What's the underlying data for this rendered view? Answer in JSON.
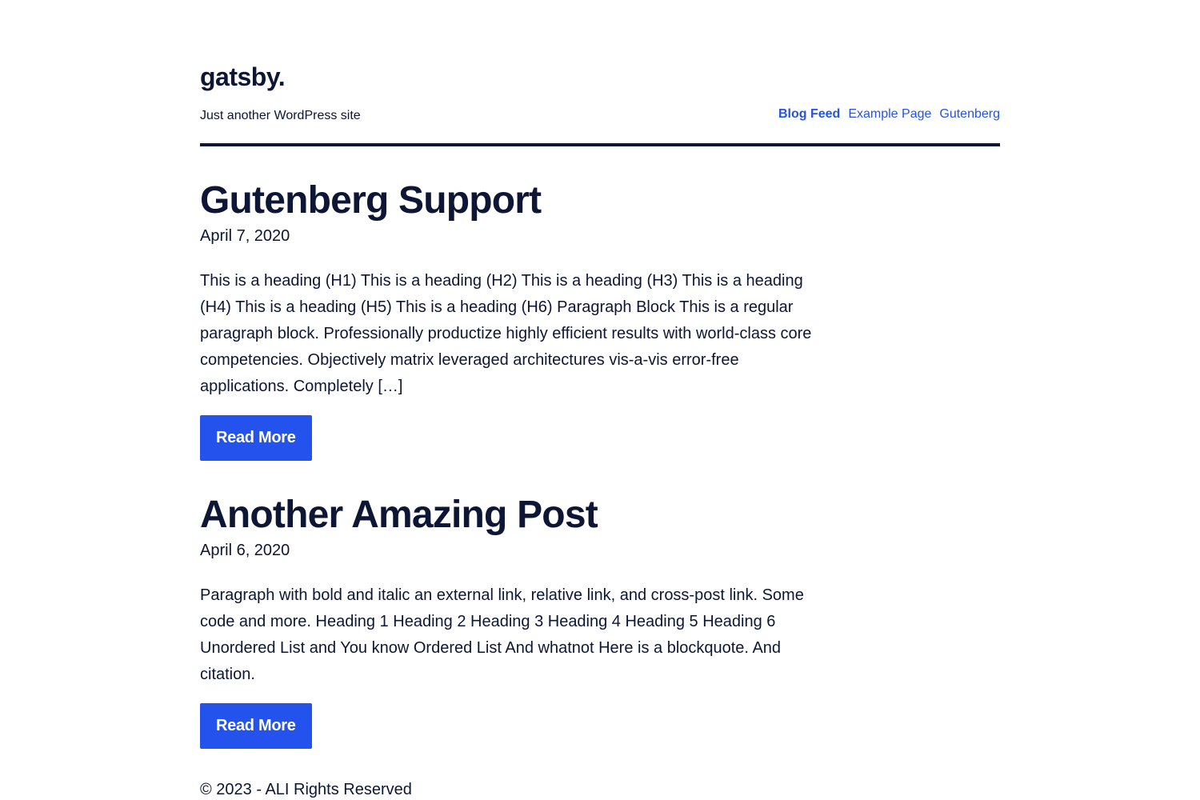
{
  "site": {
    "title": "gatsby.",
    "tagline": "Just another WordPress site"
  },
  "nav": {
    "items": [
      {
        "label": "Blog Feed"
      },
      {
        "label": "Example Page"
      },
      {
        "label": "Gutenberg"
      }
    ],
    "active": "Blog Feed"
  },
  "posts": [
    {
      "title": "Gutenberg Support",
      "date": "April 7, 2020",
      "excerpt": "This is a heading (H1) This is a heading (H2) This is a heading (H3) This is a heading (H4) This is a heading (H5) This is a heading (H6) Paragraph Block This is a regular paragraph block. Professionally productize highly efficient results with world-class core competencies. Objectively matrix leveraged architectures vis-a-vis error-free applications. Completely […]",
      "button": "Read More"
    },
    {
      "title": "Another Amazing Post",
      "date": "April 6, 2020",
      "excerpt": "Paragraph with bold and italic an external link, relative link, and cross-post link. Some code and more. Heading 1 Heading 2 Heading 3 Heading 4 Heading 5 Heading 6 Unordered List and You know Ordered List And whatnot Here is a blockquote. And citation.",
      "button": "Read More"
    }
  ],
  "footer": {
    "text": "© 2023 - ALI Rights Reserved"
  },
  "colors": {
    "text": "#0d1634",
    "accent": "#2353ec",
    "background": "#ffffff"
  }
}
